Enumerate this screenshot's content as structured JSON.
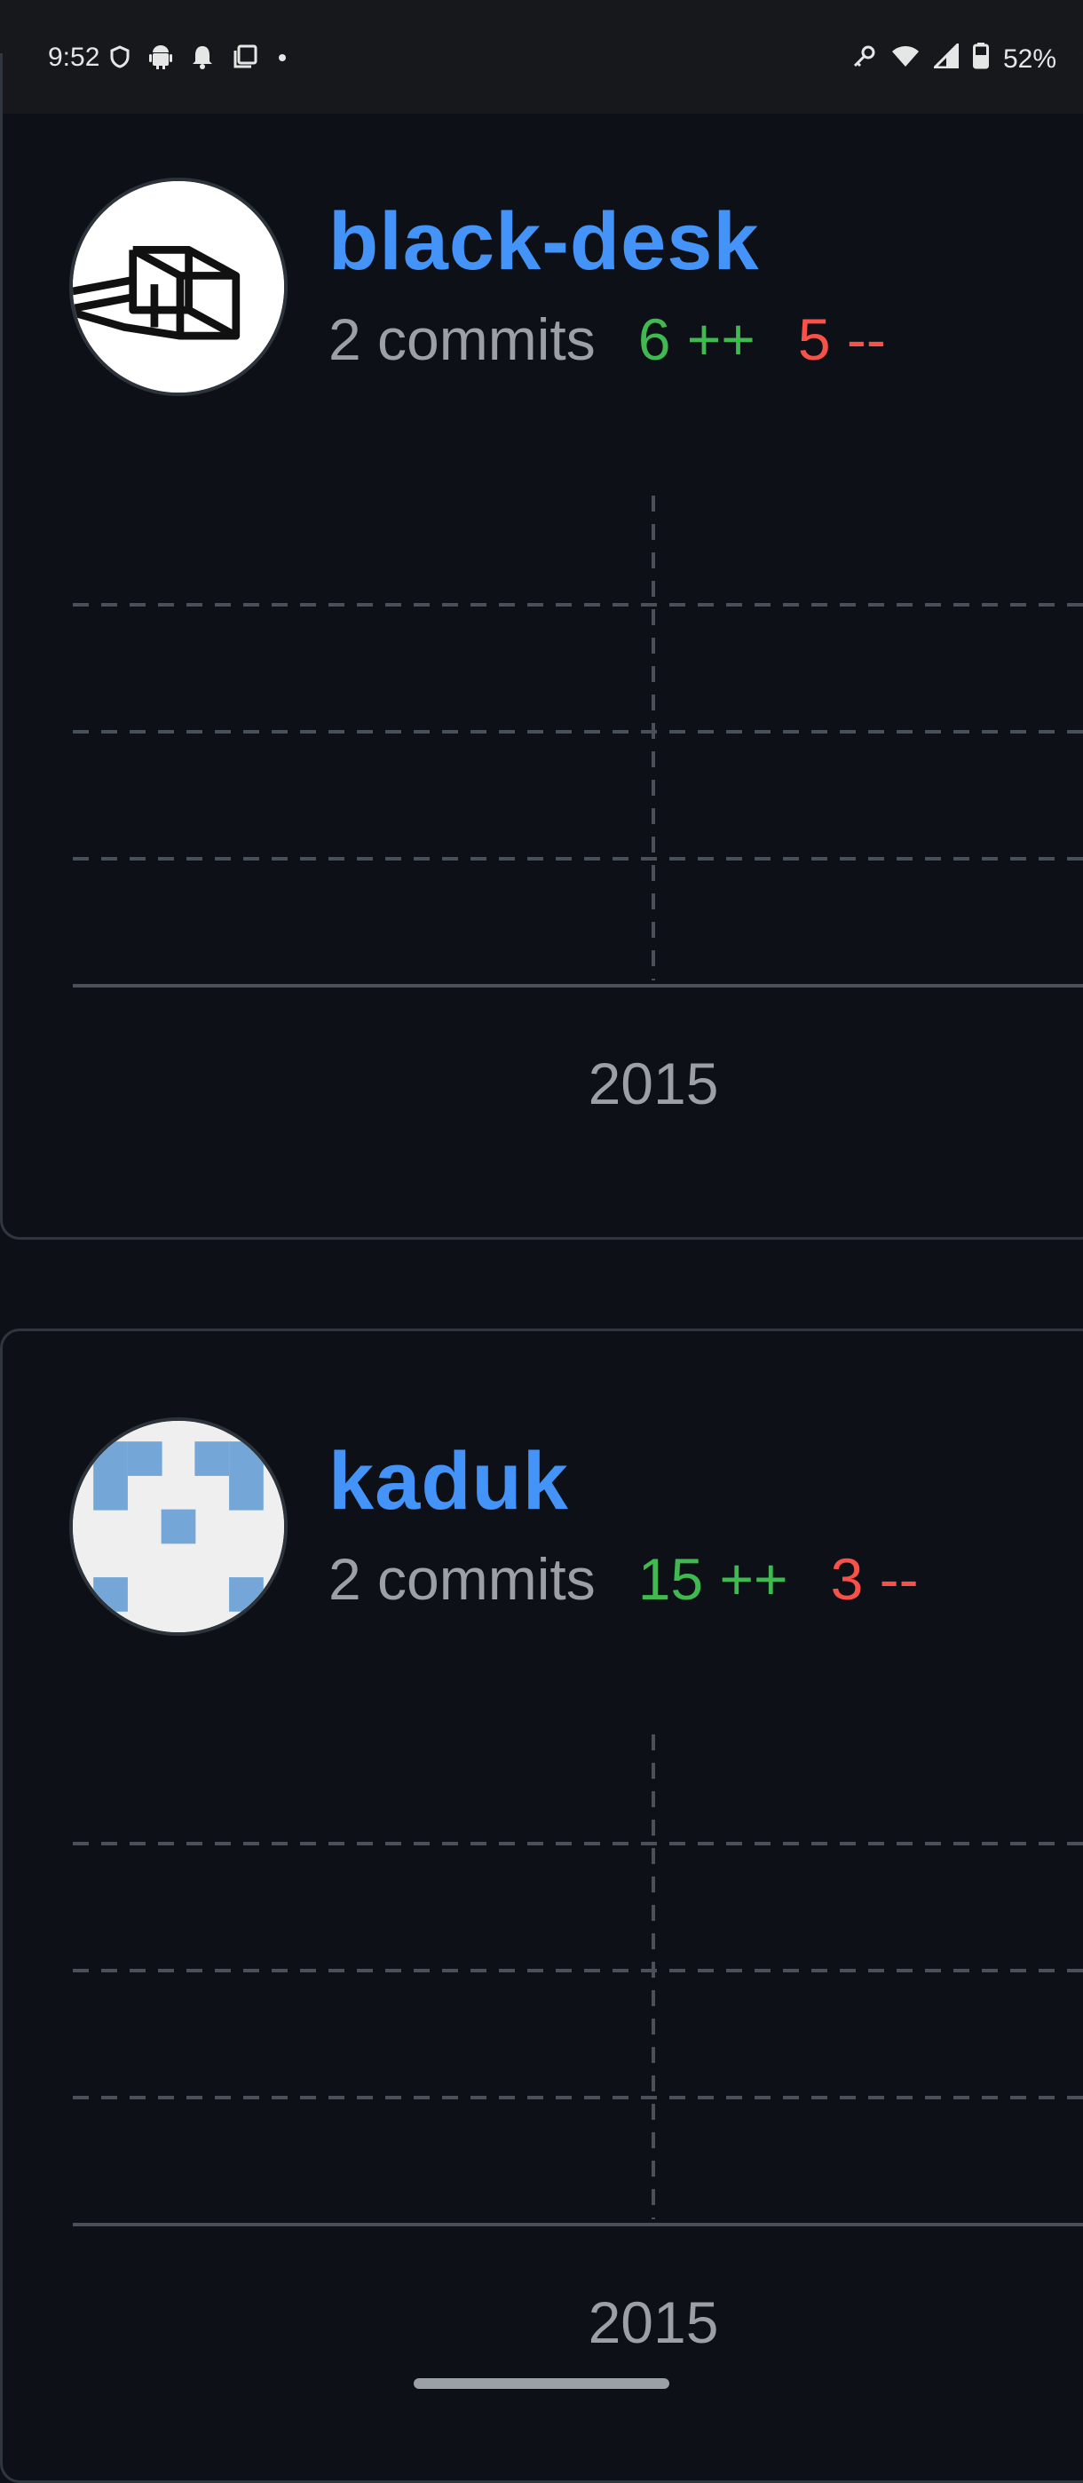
{
  "status_bar": {
    "time": "9:52",
    "battery": "52%",
    "left_icons": [
      "vpn-icon",
      "android-icon",
      "notification-bell-icon",
      "screen-icon",
      "dot-icon"
    ],
    "right_icons": [
      "key-icon",
      "wifi-icon",
      "signal-icon",
      "battery-icon"
    ]
  },
  "contributors": [
    {
      "name": "black-desk",
      "commits": "2 commits",
      "additions": "6 ++",
      "deletions": "5 --",
      "avatar_icon": "desk-avatar-icon",
      "chart_year": "2015"
    },
    {
      "name": "kaduk",
      "commits": "2 commits",
      "additions": "15 ++",
      "deletions": "3 --",
      "avatar_icon": "identicon-avatar-icon",
      "chart_year": "2015"
    }
  ],
  "colors": {
    "name": "#4493f8",
    "additions": "#3fb950",
    "deletions": "#f85149",
    "background": "#0d1117"
  },
  "chart_data": [
    {
      "type": "line",
      "x": [
        "2015"
      ],
      "series": [],
      "grid": true
    },
    {
      "type": "line",
      "x": [
        "2015"
      ],
      "series": [],
      "grid": true
    }
  ]
}
